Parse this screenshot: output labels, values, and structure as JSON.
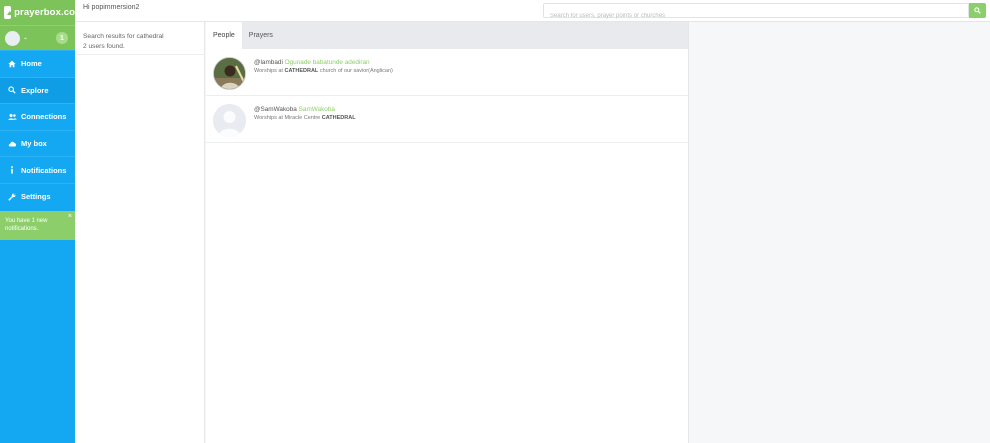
{
  "brand": {
    "name": "prayerbox.co"
  },
  "user": {
    "name": "-",
    "badge": "1"
  },
  "nav": {
    "items": [
      {
        "label": "Home",
        "icon": "home-icon"
      },
      {
        "label": "Explore",
        "icon": "search-icon"
      },
      {
        "label": "Connections",
        "icon": "users-icon"
      },
      {
        "label": "My box",
        "icon": "cloud-icon"
      },
      {
        "label": "Notifications",
        "icon": "info-icon"
      },
      {
        "label": "Settings",
        "icon": "wrench-icon"
      }
    ]
  },
  "notice": {
    "text": "You have 1 new notifications.",
    "close": "×"
  },
  "header": {
    "greeting": "Hi popimmersion2",
    "search_placeholder": "Search for users, prayer points or churches"
  },
  "results": {
    "query_line": "Search results for cathedral",
    "count_line": "2 users found."
  },
  "tabs": [
    {
      "label": "People",
      "active": true
    },
    {
      "label": "Prayers",
      "active": false
    }
  ],
  "people": [
    {
      "handle": "@lambadi",
      "name": "Ogunade babatunde adediran",
      "worship_prefix": "Worships at",
      "church_highlight": "CATHEDRAL",
      "church_rest": "church of our savior(Anglican)"
    },
    {
      "handle": "@SamWakoba",
      "name": "SamWakoba",
      "worship_prefix": "Worships at Miracle Centre",
      "church_highlight": "CATHEDRAL",
      "church_rest": ""
    }
  ],
  "colors": {
    "sidebar": "#15a8f2",
    "accent_green": "#8ccf6a",
    "brand_green": "#7cc45a"
  }
}
